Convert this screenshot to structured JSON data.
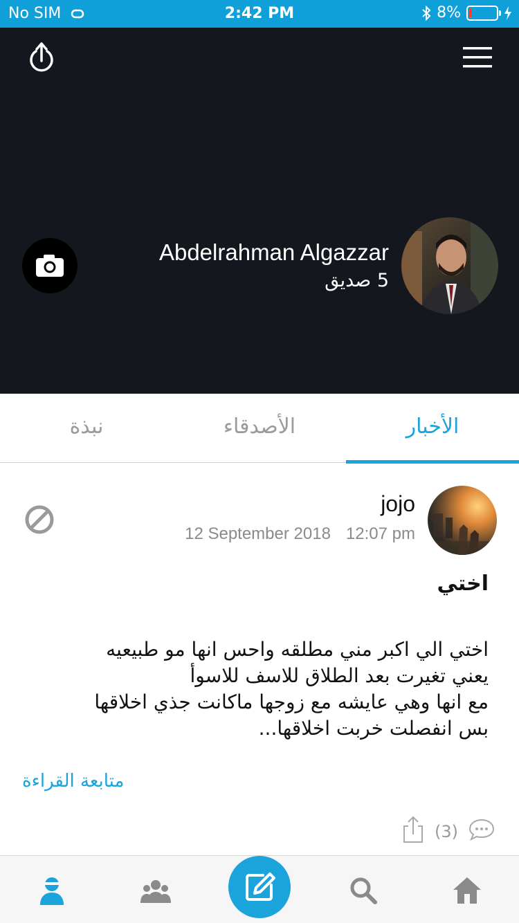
{
  "status_bar": {
    "carrier": "No SIM",
    "time": "2:42 PM",
    "battery_percent": "8%",
    "battery_level": 0.08
  },
  "profile": {
    "name": "Abdelrahman Algazzar",
    "friends": "5 صديق"
  },
  "tabs": [
    {
      "label": "الأخبار",
      "active": true
    },
    {
      "label": "الأصدقاء",
      "active": false
    },
    {
      "label": "نبذة",
      "active": false
    }
  ],
  "post": {
    "author": "jojo",
    "time": "12:07 pm",
    "date": "12 September 2018",
    "title": "اختي",
    "body_lines": [
      "اختي الي اكبر مني مطلقه واحس انها مو طبيعيه",
      "يعني تغيرت بعد الطلاق للاسف للاسوأ",
      "مع انها وهي عايشه مع زوجها ماكانت جذي اخلاقها",
      "بس انفصلت خربت اخلاقها..."
    ],
    "read_more": "متابعة القراءة",
    "comment_count": "(3)"
  },
  "colors": {
    "accent": "#1ba4dc",
    "status_bar": "#0f9fd9",
    "cover": "#15171e"
  },
  "icons": {
    "share": "share-icon",
    "menu": "hamburger-menu-icon",
    "camera": "camera-icon",
    "block": "block-icon",
    "comment": "comment-icon",
    "nav": [
      "profile-icon",
      "groups-icon",
      "compose-icon",
      "search-icon",
      "home-icon"
    ]
  }
}
